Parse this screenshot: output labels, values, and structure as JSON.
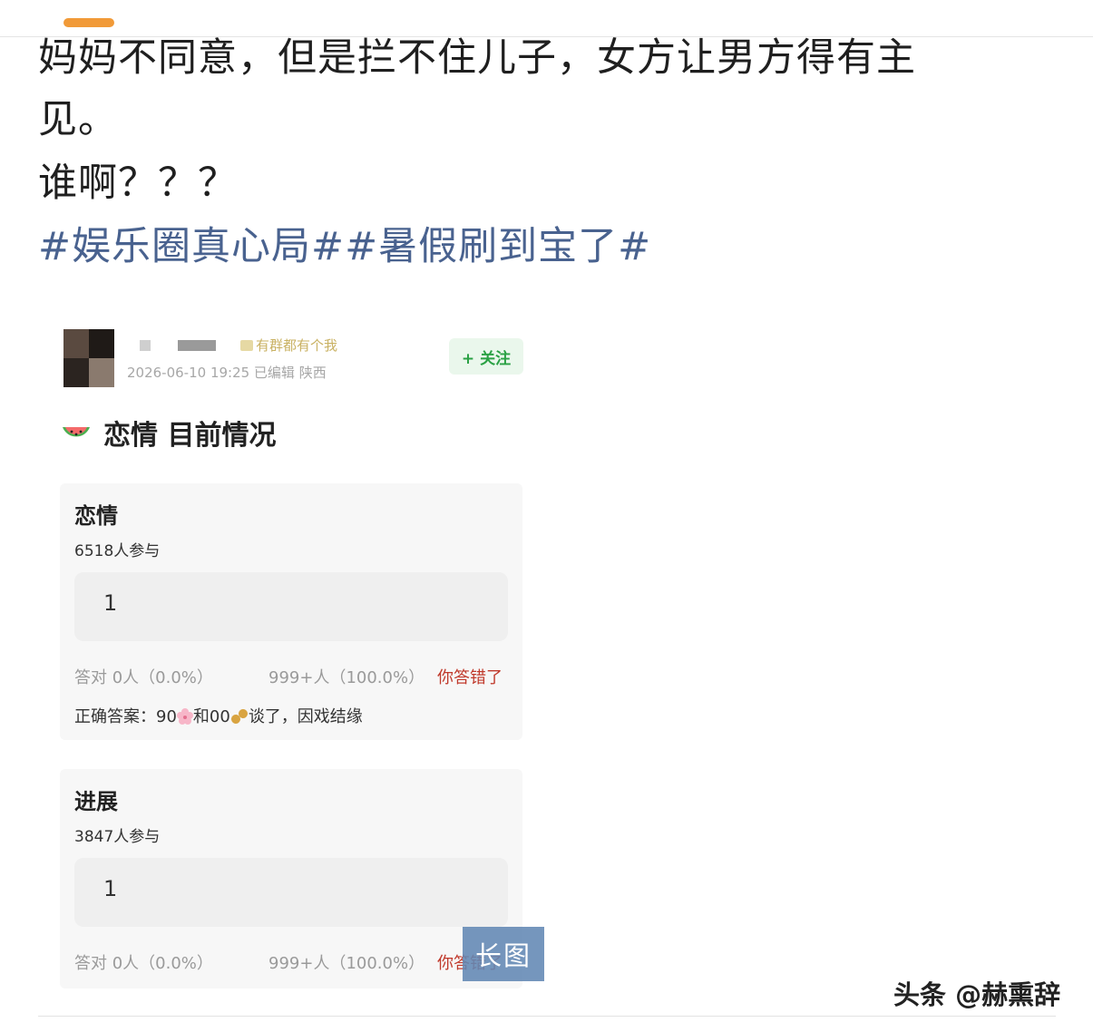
{
  "post": {
    "line1": "妈妈不同意，但是拦不住儿子，女方让男方得有主",
    "line2": "见。",
    "line3": "谁啊？？？",
    "hashtags": [
      "#娱乐圈真心局#",
      "#暑假刷到宝了#"
    ]
  },
  "embed": {
    "badge": "有群都有个我",
    "meta": "2026-06-10 19:25  已编辑  陕西",
    "follow_label": "+ 关注",
    "topic_title": "恋情 目前情况",
    "topic_icon": "watermelon-icon",
    "cards": [
      {
        "title": "恋情",
        "participants": "6518人参与",
        "option": "1",
        "correct_stat": "答对  0人（0.0%）",
        "other_stat": "999+人（100.0%）",
        "result": "你答错了",
        "answer_prefix": "正确答案：90",
        "answer_mid": "和00",
        "answer_suffix": "谈了，因戏结缘"
      },
      {
        "title": "进展",
        "participants": "3847人参与",
        "option": "1",
        "correct_stat": "答对  0人（0.0%）",
        "other_stat": "999+人（100.0%）",
        "result": "你答错了"
      }
    ]
  },
  "overlay": {
    "long_image_label": "长图",
    "watermark": "头条 @赫熏辞"
  },
  "colors": {
    "hashtag": "#49628f",
    "follow_text": "#2aa144",
    "follow_bg": "#eaf7ec",
    "wrong": "#c0392b",
    "long_badge": "#6287b4",
    "orange_tab": "#f19a38"
  }
}
